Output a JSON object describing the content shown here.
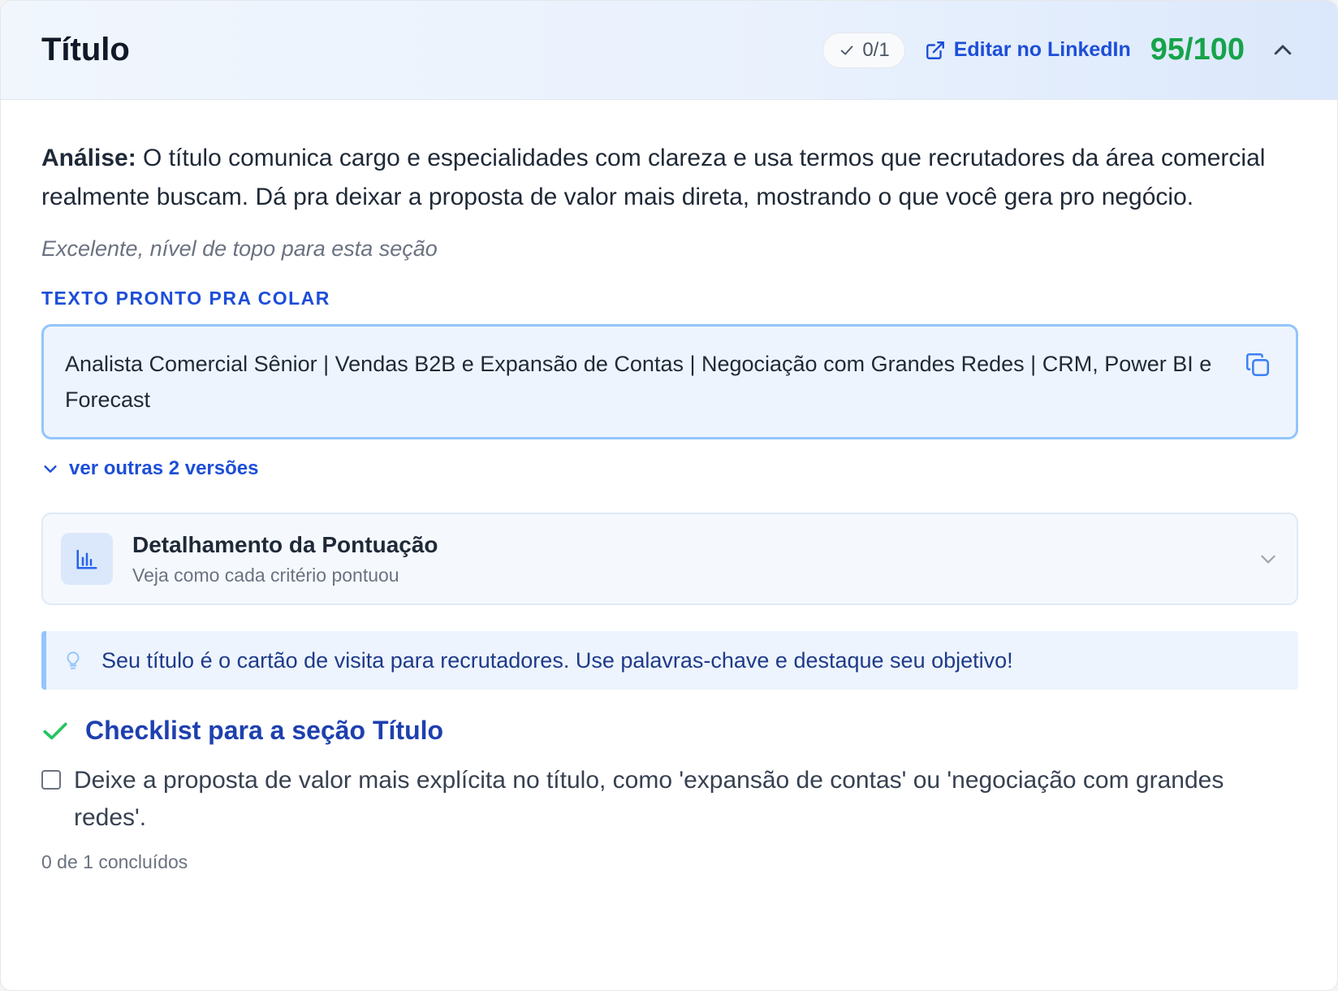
{
  "header": {
    "title": "Título",
    "progress": "0/1",
    "edit_link": "Editar no LinkedIn",
    "score": "95/100",
    "score_color": "#16a34a",
    "collapse_icon": "chevron-up-icon"
  },
  "analysis": {
    "label": "Análise:",
    "text": " O título comunica cargo e especialidades com clareza e usa termos que recrutadores da área comercial realmente buscam. Dá pra deixar a proposta de valor mais direta, mostrando o que você gera pro negócio."
  },
  "verdict": "Excelente, nível de topo para esta seção",
  "ready_text": {
    "label": "TEXTO PRONTO PRA COLAR",
    "content": "Analista Comercial Sênior | Vendas B2B e Expansão de Contas | Negociação com Grandes Redes | CRM, Power BI e Forecast",
    "copy_icon": "copy-icon"
  },
  "versions_link": "ver outras 2 versões",
  "breakdown": {
    "title": "Detalhamento da Pontuação",
    "subtitle": "Veja como cada critério pontuou",
    "icon": "bar-chart-icon"
  },
  "tip": {
    "icon": "lightbulb-icon",
    "text": "Seu título é o cartão de visita para recrutadores. Use palavras-chave e destaque seu objetivo!"
  },
  "checklist": {
    "title": "Checklist para a seção Título",
    "items": [
      {
        "text": "Deixe a proposta de valor mais explícita no título, como 'expansão de contas' ou 'negociação com grandes redes'.",
        "checked": false
      }
    ],
    "summary": "0 de 1 concluídos"
  },
  "colors": {
    "accent": "#1d4ed8",
    "success": "#16a34a",
    "box_border": "#93c5fd"
  }
}
